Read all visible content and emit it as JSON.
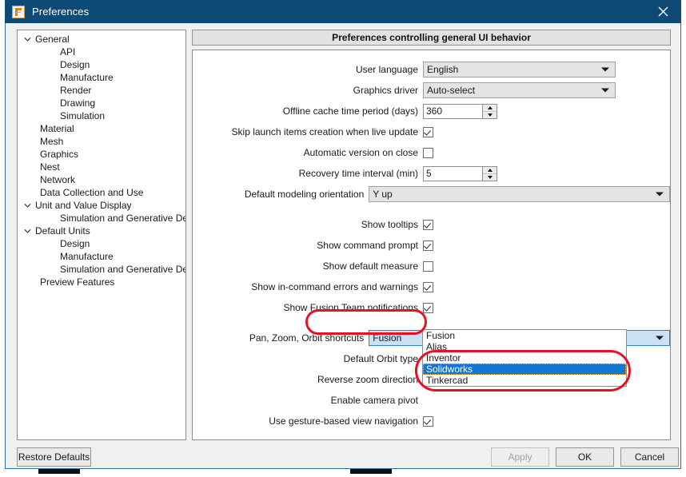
{
  "window": {
    "title": "Preferences",
    "icon": "fusion-app-icon",
    "close_icon": "close-icon"
  },
  "sidebar": {
    "items": [
      {
        "label": "General",
        "level": 0,
        "expandable": true,
        "expanded": true
      },
      {
        "label": "API",
        "level": 1,
        "expandable": false
      },
      {
        "label": "Design",
        "level": 1,
        "expandable": false
      },
      {
        "label": "Manufacture",
        "level": 1,
        "expandable": false
      },
      {
        "label": "Render",
        "level": 1,
        "expandable": false
      },
      {
        "label": "Drawing",
        "level": 1,
        "expandable": false
      },
      {
        "label": "Simulation",
        "level": 1,
        "expandable": false
      },
      {
        "label": "Material",
        "level": 0,
        "expandable": false
      },
      {
        "label": "Mesh",
        "level": 0,
        "expandable": false
      },
      {
        "label": "Graphics",
        "level": 0,
        "expandable": false
      },
      {
        "label": "Nest",
        "level": 0,
        "expandable": false
      },
      {
        "label": "Network",
        "level": 0,
        "expandable": false
      },
      {
        "label": "Data Collection and Use",
        "level": 0,
        "expandable": false
      },
      {
        "label": "Unit and Value Display",
        "level": 0,
        "expandable": true,
        "expanded": true
      },
      {
        "label": "Simulation and Generative Design",
        "level": 1,
        "expandable": false
      },
      {
        "label": "Default Units",
        "level": 0,
        "expandable": true,
        "expanded": true
      },
      {
        "label": "Design",
        "level": 1,
        "expandable": false
      },
      {
        "label": "Manufacture",
        "level": 1,
        "expandable": false
      },
      {
        "label": "Simulation and Generative Design",
        "level": 1,
        "expandable": false
      },
      {
        "label": "Preview Features",
        "level": 0,
        "expandable": false
      }
    ]
  },
  "content": {
    "header": "Preferences controlling general UI behavior",
    "fields": {
      "user_language": {
        "label": "User language",
        "value": "English"
      },
      "graphics_driver": {
        "label": "Graphics driver",
        "value": "Auto-select"
      },
      "offline_cache": {
        "label": "Offline cache time period (days)",
        "value": "360"
      },
      "skip_launch_items": {
        "label": "Skip launch items creation when live update",
        "checked": true
      },
      "automatic_version": {
        "label": "Automatic version on close",
        "checked": false
      },
      "recovery_interval": {
        "label": "Recovery time interval (min)",
        "value": "5"
      },
      "default_modeling_orientation": {
        "label": "Default modeling orientation",
        "value": "Y up"
      },
      "show_tooltips": {
        "label": "Show tooltips",
        "checked": true
      },
      "show_command_prompt": {
        "label": "Show command prompt",
        "checked": true
      },
      "show_default_measure": {
        "label": "Show default measure",
        "checked": false
      },
      "show_in_command_errors": {
        "label": "Show in-command errors and warnings",
        "checked": true
      },
      "show_fusion_team_notifications": {
        "label": "Show Fusion Team notifications",
        "checked": true
      },
      "pan_zoom_orbit_shortcuts": {
        "label": "Pan, Zoom, Orbit shortcuts",
        "value": "Fusion",
        "options": [
          "Fusion",
          "Alias",
          "Inventor",
          "Solidworks",
          "Tinkercad"
        ],
        "highlighted_option": "Solidworks",
        "open": true
      },
      "default_orbit_type": {
        "label": "Default Orbit type"
      },
      "reverse_zoom_direction": {
        "label": "Reverse zoom direction"
      },
      "enable_camera_pivot": {
        "label": "Enable camera pivot"
      },
      "use_gesture_navigation": {
        "label": "Use gesture-based view navigation",
        "checked": true
      }
    }
  },
  "footer": {
    "restore_defaults": "Restore Defaults",
    "apply": "Apply",
    "ok": "OK",
    "cancel": "Cancel"
  },
  "annotations": {
    "color": "#e81123",
    "shapes": [
      "ellipse-around-pan-zoom-orbit-label",
      "ellipse-around-dropdown-options"
    ]
  },
  "colors": {
    "titlebar": "#0d4a76",
    "selection": "#1376d6",
    "focused_combo": "#c9e0f5",
    "annotation_red": "#e81123"
  }
}
